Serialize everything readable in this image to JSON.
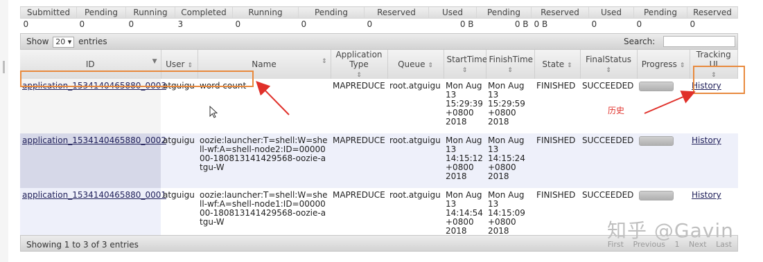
{
  "metrics": {
    "headers": [
      "Submitted",
      "Pending",
      "Running",
      "Completed",
      "Running",
      "Pending",
      "Reserved",
      "Used",
      "Pending",
      "Reserved",
      "Used",
      "Pending",
      "Reserved"
    ],
    "values": [
      "0",
      "0",
      "0",
      "3",
      "0",
      "0",
      "0",
      "0 B",
      "0 B",
      "0 B",
      "0",
      "0",
      "0"
    ]
  },
  "toolbar": {
    "show_prefix": "Show",
    "entries_value": "20",
    "show_suffix": "entries",
    "search_label": "Search:"
  },
  "columns": {
    "id": "ID",
    "user": "User",
    "name": "Name",
    "app_type": "Application Type",
    "queue": "Queue",
    "start": "StartTime",
    "finish": "FinishTime",
    "state": "State",
    "final": "FinalStatus",
    "progress": "Progress",
    "tracking": "Tracking UI"
  },
  "rows": [
    {
      "id": "application_1534140465880_0003",
      "user": "atguigu",
      "name": "word count",
      "app_type": "MAPREDUCE",
      "queue": "root.atguigu",
      "start": "Mon Aug 13 15:29:39 +0800 2018",
      "finish": "Mon Aug 13 15:29:59 +0800 2018",
      "state": "FINISHED",
      "final": "SUCCEEDED",
      "progress": 1.0,
      "tracking": "History"
    },
    {
      "id": "application_1534140465880_0002",
      "user": "atguigu",
      "name": "oozie:launcher:T=shell:W=shell-wf:A=shell-node2:ID=0000000-180813141429568-oozie-atgu-W",
      "app_type": "MAPREDUCE",
      "queue": "root.atguigu",
      "start": "Mon Aug 13 14:15:12 +0800 2018",
      "finish": "Mon Aug 13 14:15:24 +0800 2018",
      "state": "FINISHED",
      "final": "SUCCEEDED",
      "progress": 1.0,
      "tracking": "History"
    },
    {
      "id": "application_1534140465880_0001",
      "user": "atguigu",
      "name": "oozie:launcher:T=shell:W=shell-wf:A=shell-node1:ID=0000000-180813141429568-oozie-atgu-W",
      "app_type": "MAPREDUCE",
      "queue": "root.atguigu",
      "start": "Mon Aug 13 14:14:54 +0800 2018",
      "finish": "Mon Aug 13 14:15:09 +0800 2018",
      "state": "FINISHED",
      "final": "SUCCEEDED",
      "progress": 1.0,
      "tracking": "History"
    }
  ],
  "footer": {
    "info": "Showing 1 to 3 of 3 entries",
    "first": "First",
    "previous": "Previous",
    "page": "1",
    "next": "Next",
    "last": "Last"
  },
  "annotation": {
    "label": "历史",
    "color": "#e0302a",
    "box_color": "#e8893c"
  },
  "watermark": "知乎 @Gavin",
  "icons": {
    "sort": "sort-arrows-icon",
    "sort_desc": "sort-desc-icon",
    "dropdown": "chevron-down-icon",
    "cursor": "mouse-pointer-icon"
  }
}
